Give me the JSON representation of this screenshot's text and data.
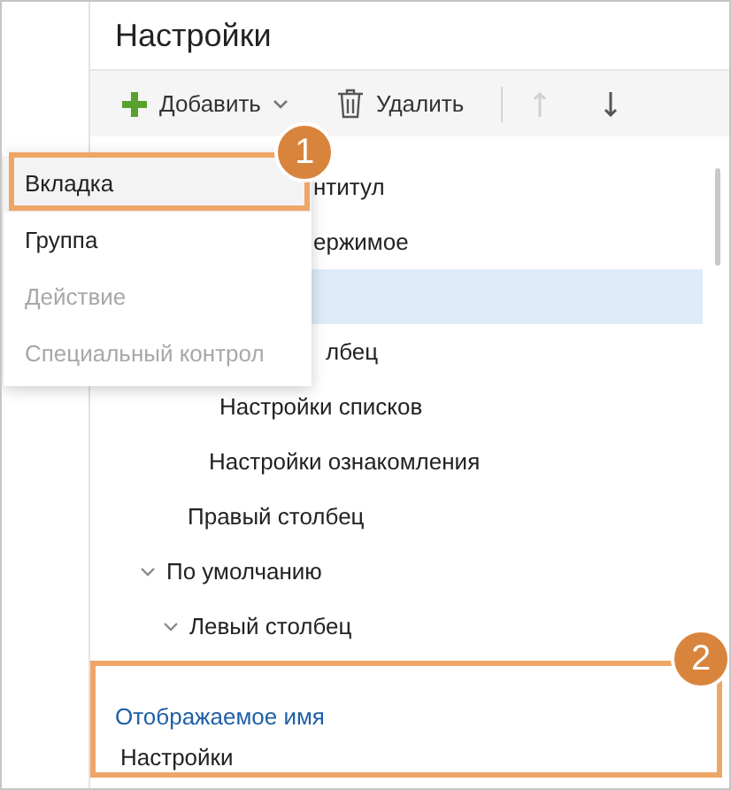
{
  "title": "Настройки",
  "toolbar": [
    {
      "kind": "add",
      "label": "Добавить",
      "disabled": false
    },
    {
      "kind": "delete",
      "label": "Удалить",
      "disabled": false
    },
    {
      "kind": "up",
      "disabled": true
    },
    {
      "kind": "down",
      "disabled": false
    }
  ],
  "tree_rows": [
    {
      "label": "нтитул",
      "selected": false
    },
    {
      "label": "ержимое",
      "selected": false
    },
    {
      "selected": true
    },
    {
      "label": "лбец",
      "selected": false
    },
    {
      "label": "Настройки списков",
      "selected": false
    },
    {
      "label": "Настройки ознакомления",
      "selected": false
    },
    {
      "label": "Правый столбец",
      "selected": false
    },
    {
      "label": "По умолчанию",
      "selected": false,
      "expanded": true
    },
    {
      "label": "Левый столбец",
      "selected": false,
      "expanded": true
    }
  ],
  "menu": [
    {
      "label": "Вкладка",
      "selected": true,
      "disabled": false
    },
    {
      "label": "Группа",
      "selected": false,
      "disabled": false
    },
    {
      "label": "Действие",
      "selected": false,
      "disabled": true
    },
    {
      "label": "Специальный контрол",
      "selected": false,
      "disabled": true
    }
  ],
  "property": {
    "label": "Отображаемое имя",
    "value": "Настройки"
  },
  "callouts": [
    "1",
    "2"
  ]
}
